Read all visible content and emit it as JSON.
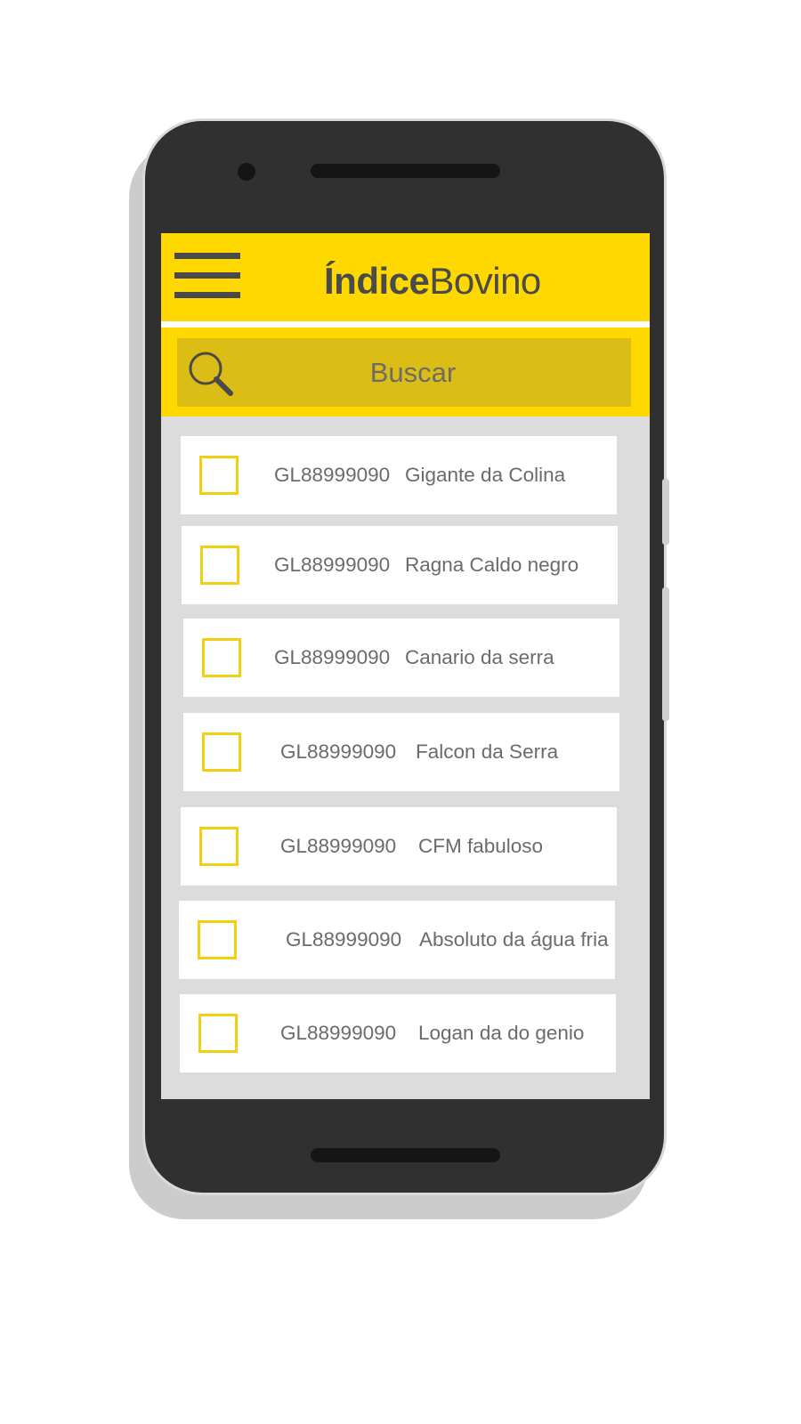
{
  "app": {
    "title_bold": "Índice",
    "title_light": "Bovino"
  },
  "search": {
    "placeholder": "Buscar"
  },
  "colors": {
    "header": "#ffd800",
    "search_box": "#dcbd16",
    "checkbox_border": "#f2cf12",
    "text": "#6b6b6b",
    "list_bg": "#dcdcdc"
  },
  "icons": {
    "menu": "hamburger-menu-icon",
    "search": "magnifier-icon"
  },
  "animals": [
    {
      "code": "GL88999090",
      "name": "Gigante da Colina",
      "checked": false
    },
    {
      "code": "GL88999090",
      "name": "Ragna Caldo negro",
      "checked": false
    },
    {
      "code": "GL88999090",
      "name": "Canario da serra",
      "checked": false
    },
    {
      "code": "GL88999090",
      "name": "Falcon da Serra",
      "checked": false
    },
    {
      "code": "GL88999090",
      "name": "CFM fabuloso",
      "checked": false
    },
    {
      "code": "GL88999090",
      "name": "Absoluto da água fria",
      "checked": false
    },
    {
      "code": "GL88999090",
      "name": "Logan da do genio",
      "checked": false
    }
  ]
}
